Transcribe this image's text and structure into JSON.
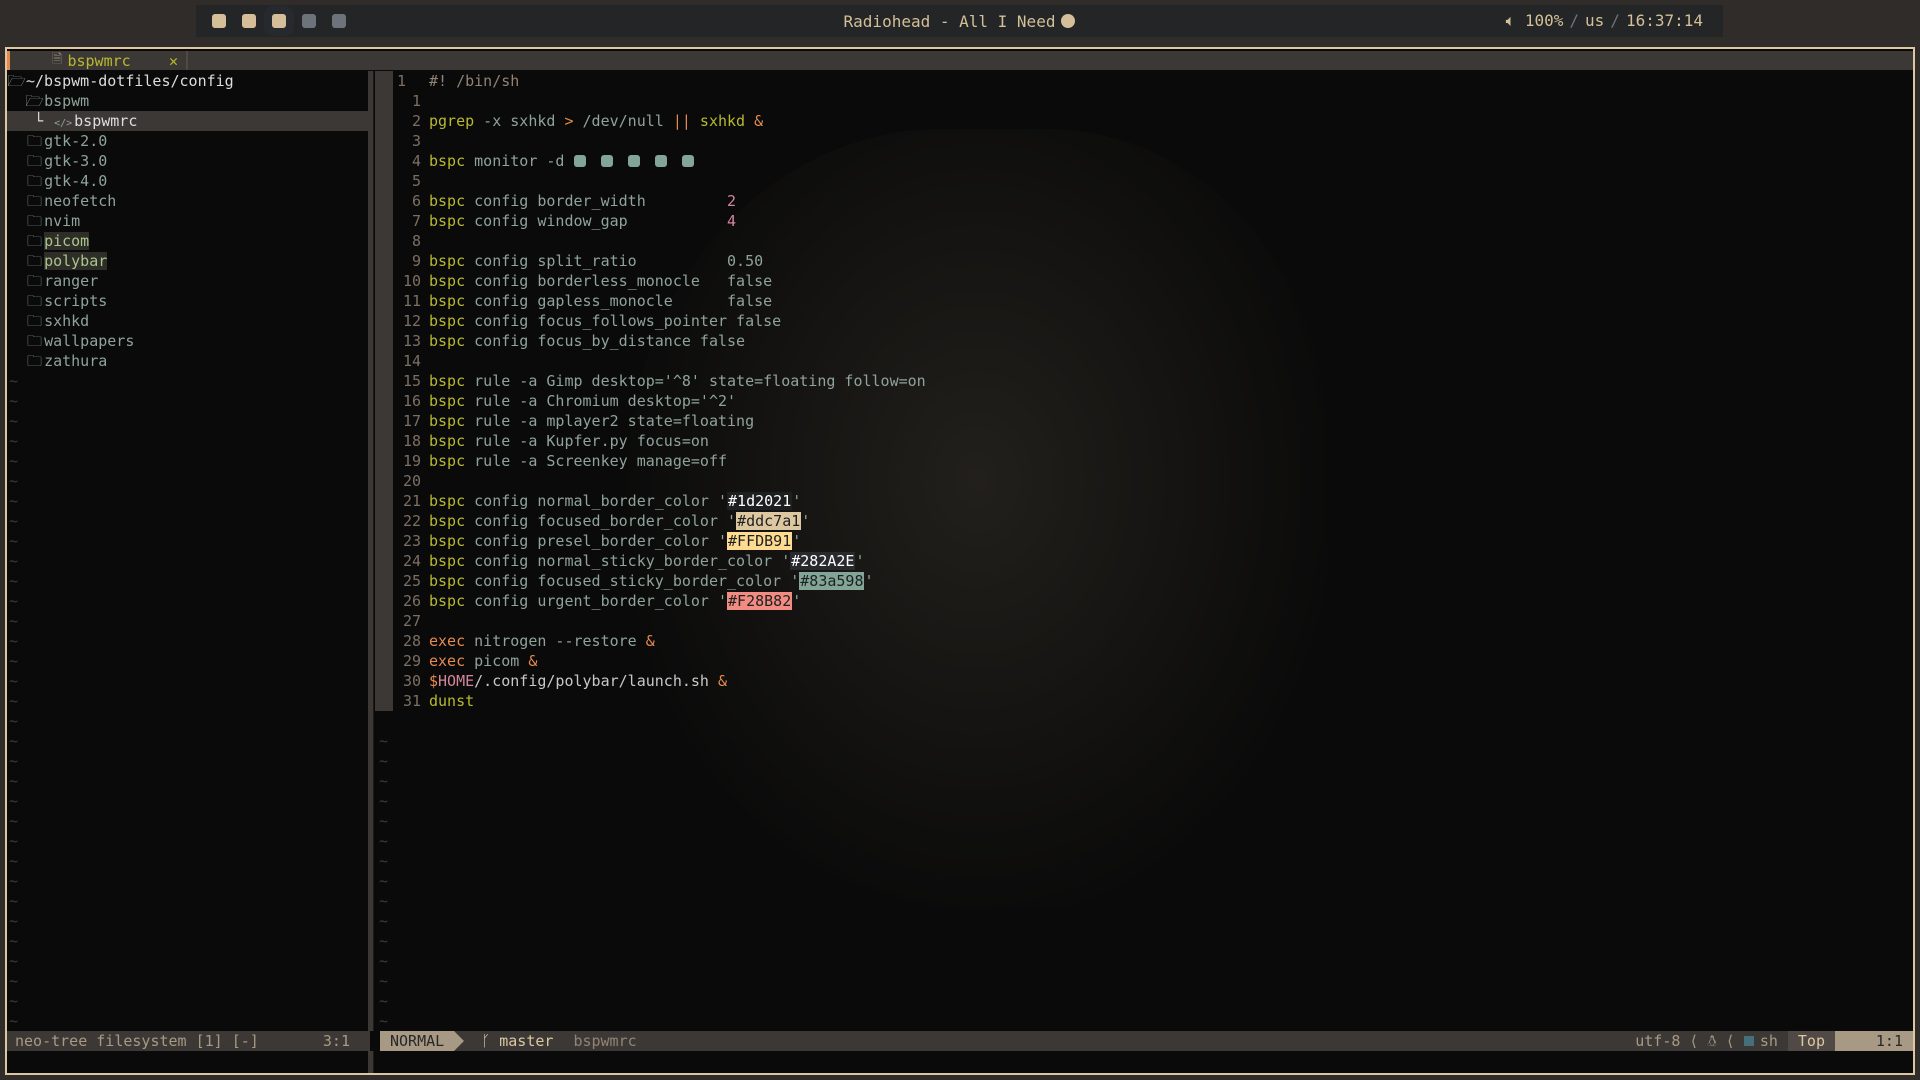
{
  "topbar": {
    "workspaces": [
      {
        "active": true
      },
      {
        "active": true
      },
      {
        "active": true,
        "current": true
      },
      {
        "active": false
      },
      {
        "active": false
      }
    ],
    "song": "Radiohead - All I Need",
    "song_icon": "spotify-icon",
    "volume": "100%",
    "layout": "us",
    "clock": "16:37:14",
    "separator": "/"
  },
  "tab": {
    "label": "bspwmrc",
    "close": "✕"
  },
  "tree": {
    "root": "~/bspwm-dotfiles/config",
    "items": [
      {
        "label": "bspwm",
        "type": "open-folder",
        "depth": 1
      },
      {
        "label": "bspwmrc",
        "type": "file",
        "depth": 2,
        "selected": true
      },
      {
        "label": "gtk-2.0",
        "type": "folder",
        "depth": 1
      },
      {
        "label": "gtk-3.0",
        "type": "folder",
        "depth": 1
      },
      {
        "label": "gtk-4.0",
        "type": "folder",
        "depth": 1
      },
      {
        "label": "neofetch",
        "type": "folder",
        "depth": 1
      },
      {
        "label": "nvim",
        "type": "folder",
        "depth": 1
      },
      {
        "label": "picom",
        "type": "folder",
        "depth": 1,
        "modified": true
      },
      {
        "label": "polybar",
        "type": "folder",
        "depth": 1,
        "modified": true
      },
      {
        "label": "ranger",
        "type": "folder",
        "depth": 1
      },
      {
        "label": "scripts",
        "type": "folder",
        "depth": 1
      },
      {
        "label": "sxhkd",
        "type": "folder",
        "depth": 1
      },
      {
        "label": "wallpapers",
        "type": "folder",
        "depth": 1
      },
      {
        "label": "zathura",
        "type": "folder",
        "depth": 1
      }
    ]
  },
  "editor": {
    "lines": [
      {
        "n": "1",
        "tokens": [
          [
            "c",
            "#! /bin/sh"
          ]
        ]
      },
      {
        "n": "1",
        "tokens": []
      },
      {
        "n": "2",
        "tokens": [
          [
            "k",
            "pgrep"
          ],
          [
            "t",
            " -x sxhkd "
          ],
          [
            "o",
            ">"
          ],
          [
            "t",
            " /dev/null "
          ],
          [
            "o",
            "||"
          ],
          [
            "k",
            " sxhkd"
          ],
          [
            "o",
            " &"
          ]
        ]
      },
      {
        "n": "3",
        "tokens": []
      },
      {
        "n": "4",
        "tokens": [
          [
            "k",
            "bspc"
          ],
          [
            "t",
            " monitor -d "
          ]
        ],
        "squares": 5
      },
      {
        "n": "5",
        "tokens": []
      },
      {
        "n": "6",
        "tokens": [
          [
            "k",
            "bspc"
          ],
          [
            "t",
            " config border_width         "
          ],
          [
            "n",
            "2"
          ]
        ]
      },
      {
        "n": "7",
        "tokens": [
          [
            "k",
            "bspc"
          ],
          [
            "t",
            " config window_gap           "
          ],
          [
            "n",
            "4"
          ]
        ]
      },
      {
        "n": "8",
        "tokens": []
      },
      {
        "n": "9",
        "tokens": [
          [
            "k",
            "bspc"
          ],
          [
            "t",
            " config split_ratio          0.50"
          ]
        ]
      },
      {
        "n": "10",
        "tokens": [
          [
            "k",
            "bspc"
          ],
          [
            "t",
            " config borderless_monocle   false"
          ]
        ]
      },
      {
        "n": "11",
        "tokens": [
          [
            "k",
            "bspc"
          ],
          [
            "t",
            " config gapless_monocle      false"
          ]
        ]
      },
      {
        "n": "12",
        "tokens": [
          [
            "k",
            "bspc"
          ],
          [
            "t",
            " config focus_follows_pointer false"
          ]
        ]
      },
      {
        "n": "13",
        "tokens": [
          [
            "k",
            "bspc"
          ],
          [
            "t",
            " config focus_by_distance false"
          ]
        ]
      },
      {
        "n": "14",
        "tokens": []
      },
      {
        "n": "15",
        "tokens": [
          [
            "k",
            "bspc"
          ],
          [
            "t",
            " rule -a Gimp desktop='^8' state=floating follow=on"
          ]
        ]
      },
      {
        "n": "16",
        "tokens": [
          [
            "k",
            "bspc"
          ],
          [
            "t",
            " rule -a Chromium desktop='^2'"
          ]
        ]
      },
      {
        "n": "17",
        "tokens": [
          [
            "k",
            "bspc"
          ],
          [
            "t",
            " rule -a mplayer2 state=floating"
          ]
        ]
      },
      {
        "n": "18",
        "tokens": [
          [
            "k",
            "bspc"
          ],
          [
            "t",
            " rule -a Kupfer.py focus=on"
          ]
        ]
      },
      {
        "n": "19",
        "tokens": [
          [
            "k",
            "bspc"
          ],
          [
            "t",
            " rule -a Screenkey manage=off"
          ]
        ]
      },
      {
        "n": "20",
        "tokens": []
      },
      {
        "n": "21",
        "tokens": [
          [
            "k",
            "bspc"
          ],
          [
            "t",
            " config normal_border_color '"
          ]
        ],
        "color": "#1d2021",
        "fg": "#ffffff",
        "after": "'"
      },
      {
        "n": "22",
        "tokens": [
          [
            "k",
            "bspc"
          ],
          [
            "t",
            " config focused_border_color '"
          ]
        ],
        "color": "#ddc7a1",
        "fg": "#1d2021",
        "after": "'"
      },
      {
        "n": "23",
        "tokens": [
          [
            "k",
            "bspc"
          ],
          [
            "t",
            " config presel_border_color '"
          ]
        ],
        "color": "#FFDB91",
        "fg": "#1d2021",
        "after": "'"
      },
      {
        "n": "24",
        "tokens": [
          [
            "k",
            "bspc"
          ],
          [
            "t",
            " config normal_sticky_border_color '"
          ]
        ],
        "color": "#282A2E",
        "fg": "#ffffff",
        "after": "'"
      },
      {
        "n": "25",
        "tokens": [
          [
            "k",
            "bspc"
          ],
          [
            "t",
            " config focused_sticky_border_color '"
          ]
        ],
        "color": "#83a598",
        "fg": "#1d2021",
        "after": "'"
      },
      {
        "n": "26",
        "tokens": [
          [
            "k",
            "bspc"
          ],
          [
            "t",
            " config urgent_border_color '"
          ]
        ],
        "color": "#F28B82",
        "fg": "#1d2021",
        "after": "'"
      },
      {
        "n": "27",
        "tokens": []
      },
      {
        "n": "28",
        "tokens": [
          [
            "o",
            "exec"
          ],
          [
            "t",
            " nitrogen --restore "
          ],
          [
            "o",
            "&"
          ]
        ]
      },
      {
        "n": "29",
        "tokens": [
          [
            "o",
            "exec"
          ],
          [
            "t",
            " picom "
          ],
          [
            "o",
            "&"
          ]
        ]
      },
      {
        "n": "30",
        "tokens": [
          [
            "o",
            "$"
          ],
          [
            "n",
            "HOME"
          ],
          [
            "w",
            "/.config/polybar/launch.sh "
          ],
          [
            "o",
            "&"
          ]
        ]
      },
      {
        "n": "31",
        "tokens": [
          [
            "k",
            "dunst"
          ]
        ]
      }
    ]
  },
  "status": {
    "left": "neo-tree filesystem [1] [-]",
    "left_pos": "3:1",
    "mode": "NORMAL",
    "branch": "master",
    "file": "bspwmrc",
    "encoding": "utf-8",
    "os_icon": "linux-icon",
    "filetype": "sh",
    "scroll": "Top",
    "position": "1:1"
  }
}
